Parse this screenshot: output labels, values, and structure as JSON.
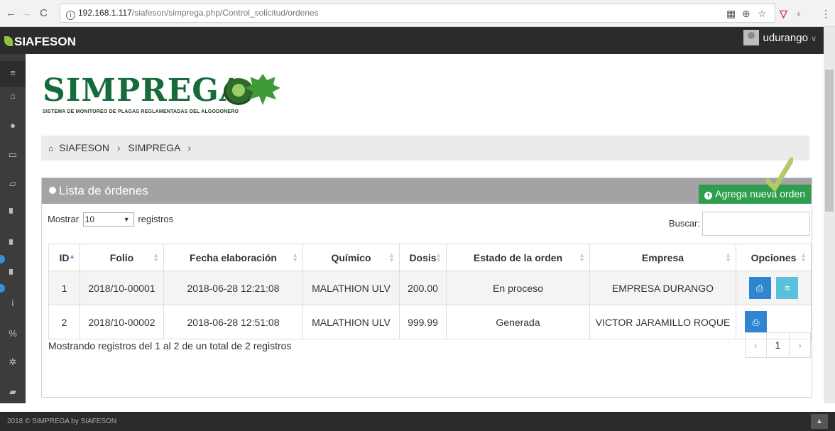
{
  "browser": {
    "url_host": "192.168.1.117",
    "url_path": "/siafeson/simprega.php/Control_solicitud/ordenes",
    "back_icon": "arrow-left-icon",
    "forward_icon": "arrow-right-icon",
    "reload_icon": "reload-icon",
    "info_icon": "info-icon",
    "extension_icons": [
      "translate-icon",
      "zoom-icon",
      "star-icon",
      "shield-icon",
      "circle-icon",
      "menu-icon"
    ]
  },
  "app": {
    "brand": "SIAFESON",
    "user": "udurango"
  },
  "sidebar": {
    "items": [
      "menu-icon",
      "home-icon",
      "android-icon",
      "folder-icon",
      "folder-open-icon",
      "file-icon",
      "file-icon",
      "file-icon",
      "info-icon",
      "link-icon",
      "gear-icon",
      "book-icon"
    ]
  },
  "logo": {
    "title": "SIMPREGA",
    "subtitle": "SISTEMA DE MONITOREO DE PLAGAS REGLAMENTADAS DEL ALGODONERO"
  },
  "breadcrumb": {
    "items": [
      "SIAFESON",
      "SIMPREGA"
    ]
  },
  "panel": {
    "title": "Lista de órdenes",
    "add_button": "Agrega nueva orden"
  },
  "controls": {
    "show_label": "Mostrar",
    "show_value": "10",
    "records_label": "registros",
    "search_label": "Buscar:"
  },
  "table": {
    "headers": [
      "ID",
      "Folio",
      "Fecha elaboración",
      "Químico",
      "Dosis",
      "Estado de la orden",
      "Empresa",
      "Opciones"
    ],
    "rows": [
      {
        "id": "1",
        "folio": "2018/10-00001",
        "fecha": "2018-06-28 12:21:08",
        "quimico": "MALATHION ULV",
        "dosis": "200.00",
        "estado": "En proceso",
        "empresa": "EMPRESA DURANGO"
      },
      {
        "id": "2",
        "folio": "2018/10-00002",
        "fecha": "2018-06-28 12:51:08",
        "quimico": "MALATHION ULV",
        "dosis": "999.99",
        "estado": "Generada",
        "empresa": "VICTOR JARAMILLO ROQUE"
      }
    ]
  },
  "footer": {
    "info": "Mostrando registros del 1 al 2 de un total de 2 registros",
    "page_prev": "‹",
    "page_current": "1",
    "page_next": "›",
    "copyright": "2018 © SIMPREGA by SIAFESON"
  },
  "colors": {
    "accent_green": "#2e9e4e",
    "print_blue": "#2f85d0",
    "menu_cyan": "#5bc0de",
    "panel_gray": "#a3a3a3",
    "check_green": "#b5c96a"
  }
}
